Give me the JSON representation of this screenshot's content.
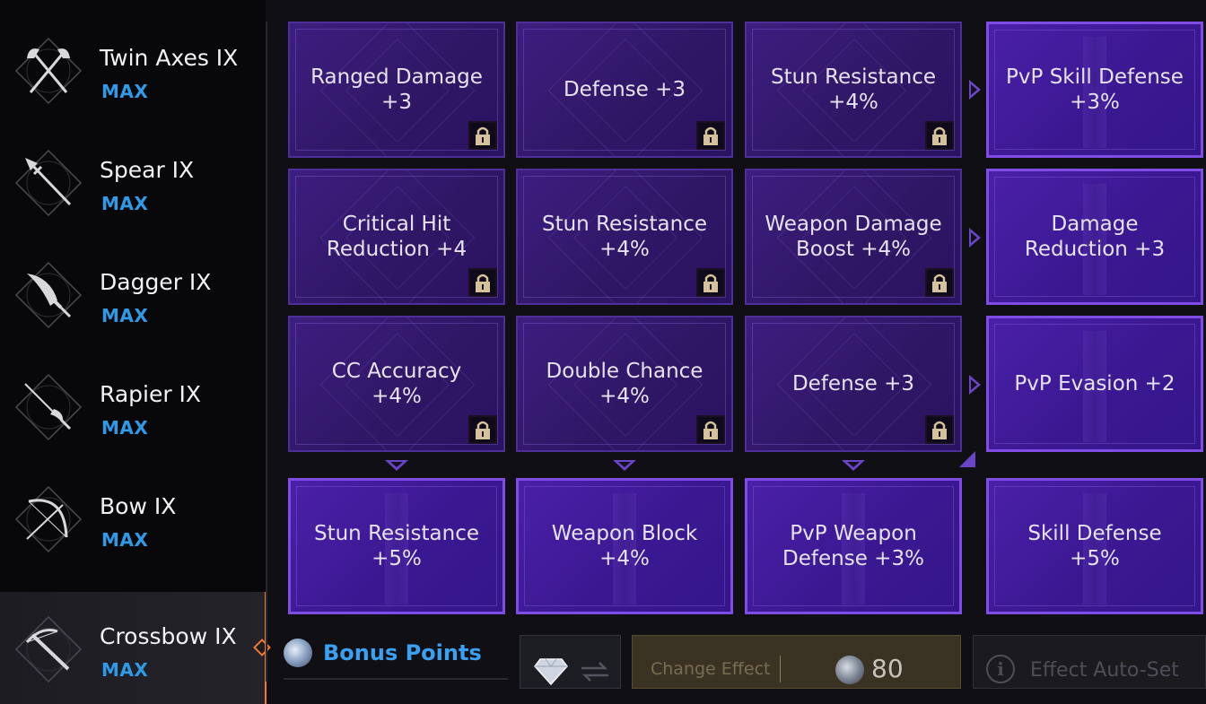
{
  "weapons": [
    {
      "name": "Twin Axes IX",
      "level": "MAX",
      "icon": "twin-axes-icon"
    },
    {
      "name": "Spear IX",
      "level": "MAX",
      "icon": "spear-icon"
    },
    {
      "name": "Dagger IX",
      "level": "MAX",
      "icon": "dagger-icon"
    },
    {
      "name": "Rapier IX",
      "level": "MAX",
      "icon": "rapier-icon"
    },
    {
      "name": "Bow IX",
      "level": "MAX",
      "icon": "bow-icon"
    },
    {
      "name": "Crossbow IX",
      "level": "MAX",
      "icon": "crossbow-icon",
      "selected": true
    }
  ],
  "grid": {
    "rows": [
      [
        {
          "l1": "Ranged Damage",
          "l2": "+3",
          "locked": true
        },
        {
          "l1": "Defense  +3",
          "l2": "",
          "locked": true
        },
        {
          "l1": "Stun Resistance",
          "l2": "+4%",
          "locked": true
        },
        {
          "l1": "PvP Skill Defense",
          "l2": "+3%",
          "locked": false
        }
      ],
      [
        {
          "l1": "Critical Hit",
          "l2": "Reduction  +4",
          "locked": true
        },
        {
          "l1": "Stun Resistance",
          "l2": "+4%",
          "locked": true
        },
        {
          "l1": "Weapon Damage",
          "l2": "Boost  +4%",
          "locked": true
        },
        {
          "l1": "Damage",
          "l2": "Reduction  +3",
          "locked": false
        }
      ],
      [
        {
          "l1": "CC Accuracy",
          "l2": "+4%",
          "locked": true
        },
        {
          "l1": "Double Chance",
          "l2": "+4%",
          "locked": true
        },
        {
          "l1": "Defense  +3",
          "l2": "",
          "locked": true
        },
        {
          "l1": "PvP Evasion  +2",
          "l2": "",
          "locked": false
        }
      ],
      [
        {
          "l1": "Stun Resistance",
          "l2": "+5%",
          "locked": false
        },
        {
          "l1": "Weapon Block",
          "l2": "+4%",
          "locked": false
        },
        {
          "l1": "PvP Weapon",
          "l2": "Defense  +3%",
          "locked": false
        },
        {
          "l1": "Skill Defense",
          "l2": "+5%",
          "locked": false
        }
      ]
    ]
  },
  "bottom": {
    "bonus_label": "Bonus Points",
    "change_label": "Change Effect",
    "cost": "80",
    "autoset_label": "Effect Auto-Set",
    "info_glyph": "i"
  },
  "colors": {
    "accent_blue": "#2f9be8",
    "selection_orange": "#f07a30",
    "cell_purple": "#3b1892",
    "cell_border_bright": "#7f4ce6"
  }
}
